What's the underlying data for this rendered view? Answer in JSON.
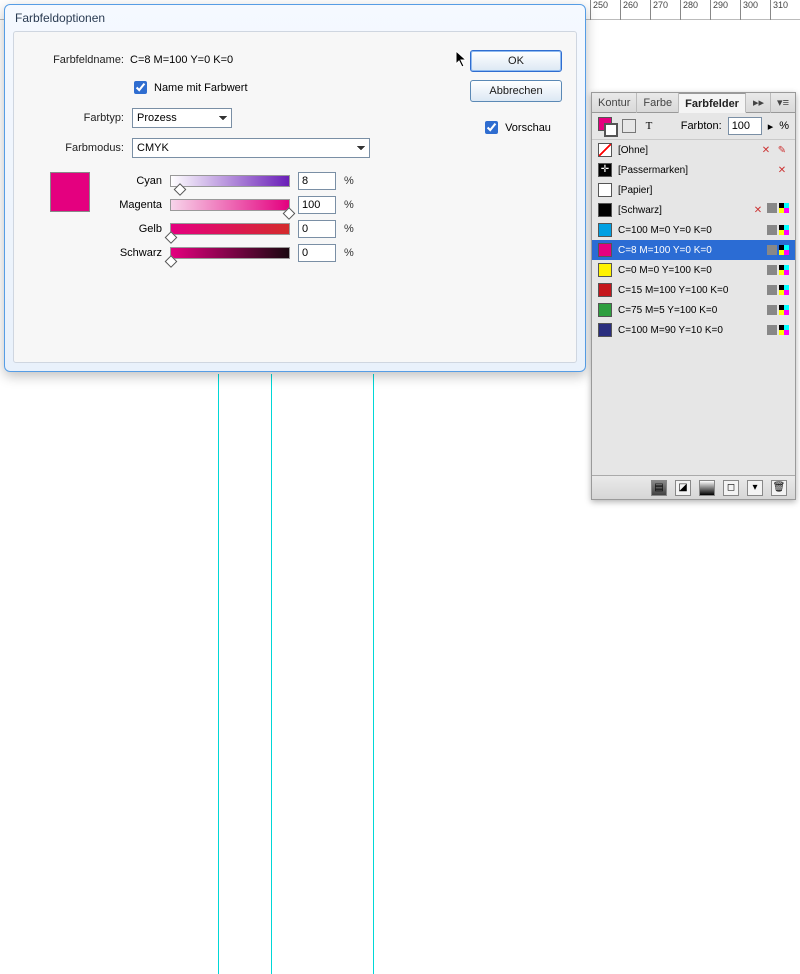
{
  "ruler_ticks": [
    "250",
    "260",
    "270",
    "280",
    "290",
    "300",
    "310"
  ],
  "dialog": {
    "title": "Farbfeldoptionen",
    "name_label": "Farbfeldname:",
    "name_value": "C=8 M=100 Y=0 K=0",
    "name_with_value_label": "Name mit Farbwert",
    "name_with_value_checked": true,
    "type_label": "Farbtyp:",
    "type_value": "Prozess",
    "mode_label": "Farbmodus:",
    "mode_value": "CMYK",
    "ok_label": "OK",
    "cancel_label": "Abbrechen",
    "preview_label": "Vorschau",
    "preview_checked": true,
    "preview_color": "#e4007f",
    "sliders": {
      "cyan": {
        "label": "Cyan",
        "value": "8",
        "gradient": "linear-gradient(to right,#ffffff,#6a1fb8)",
        "pos": 8
      },
      "magenta": {
        "label": "Magenta",
        "value": "100",
        "gradient": "linear-gradient(to right,#f7d4ea,#e4007f)",
        "pos": 100
      },
      "yellow": {
        "label": "Gelb",
        "value": "0",
        "gradient": "linear-gradient(to right,#e4007f,#d42b2b)",
        "pos": 0
      },
      "black": {
        "label": "Schwarz",
        "value": "0",
        "gradient": "linear-gradient(to right,#e4007f,#1a0810)",
        "pos": 0
      }
    }
  },
  "panel": {
    "tabs": {
      "kontur": "Kontur",
      "farbe": "Farbe",
      "farbfelder": "Farbfelder"
    },
    "farbton_label": "Farbton:",
    "farbton_value": "100",
    "percent": "%",
    "swatches": [
      {
        "name": "[Ohne]",
        "color": "#ffffff",
        "none": true,
        "locked": true,
        "editable": true
      },
      {
        "name": "[Passermarken]",
        "color": "#000000",
        "registration": true,
        "locked": true
      },
      {
        "name": "[Papier]",
        "color": "#ffffff"
      },
      {
        "name": "[Schwarz]",
        "color": "#000000",
        "locked": true,
        "cmyk": true
      },
      {
        "name": "C=100 M=0 Y=0 K=0",
        "color": "#00a0e3",
        "cmyk": true
      },
      {
        "name": "C=8 M=100 Y=0 K=0",
        "color": "#e4007f",
        "cmyk": true,
        "selected": true
      },
      {
        "name": "C=0 M=0 Y=100 K=0",
        "color": "#fff200",
        "cmyk": true
      },
      {
        "name": "C=15 M=100 Y=100 K=0",
        "color": "#c4161c",
        "cmyk": true
      },
      {
        "name": "C=75 M=5 Y=100 K=0",
        "color": "#2e9e3f",
        "cmyk": true
      },
      {
        "name": "C=100 M=90 Y=10 K=0",
        "color": "#2a2e7e",
        "cmyk": true
      }
    ]
  }
}
